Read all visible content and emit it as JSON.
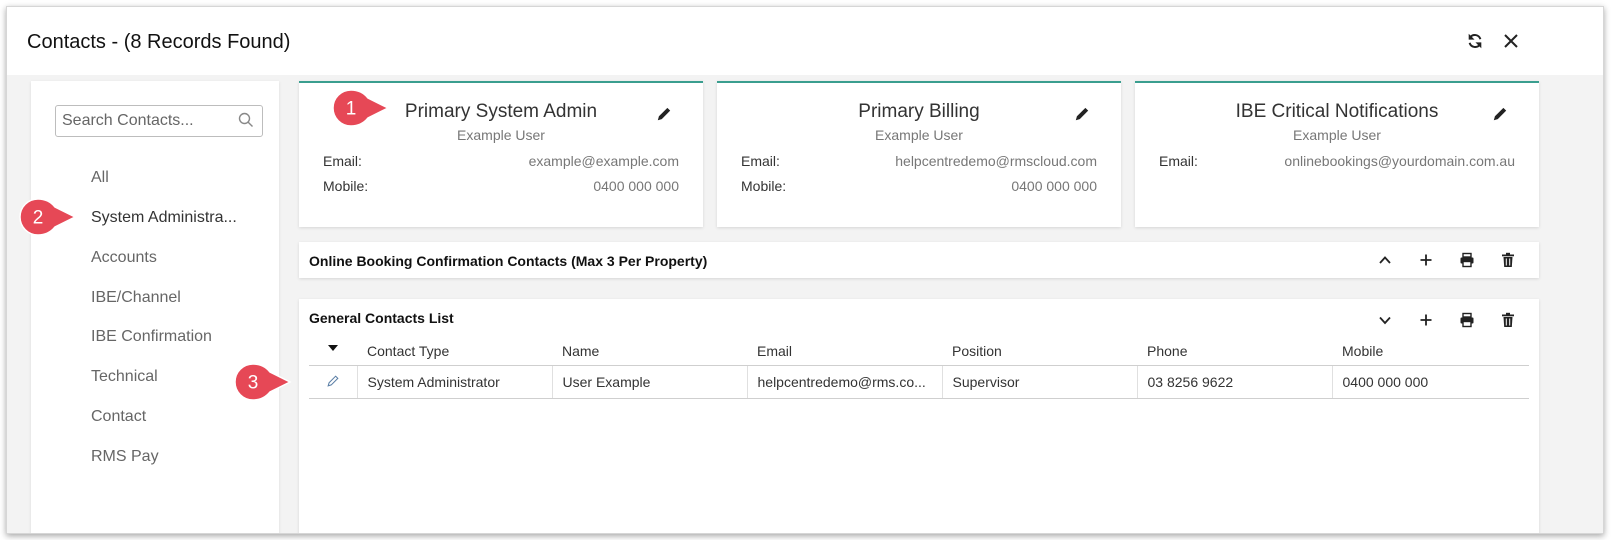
{
  "window": {
    "title": "Contacts - (8 Records Found)"
  },
  "search": {
    "placeholder": "Search Contacts..."
  },
  "sidebar": {
    "items": [
      {
        "label": "All"
      },
      {
        "label": "System Administra..."
      },
      {
        "label": "Accounts"
      },
      {
        "label": "IBE/Channel"
      },
      {
        "label": "IBE Confirmation"
      },
      {
        "label": "Technical"
      },
      {
        "label": "Contact"
      },
      {
        "label": "RMS Pay"
      }
    ],
    "active_index": 1
  },
  "cards": [
    {
      "title": "Primary System Admin",
      "subtitle": "Example User",
      "email_label": "Email:",
      "email": "example@example.com",
      "mobile_label": "Mobile:",
      "mobile": "0400 000 000"
    },
    {
      "title": "Primary Billing",
      "subtitle": "Example User",
      "email_label": "Email:",
      "email": "helpcentredemo@rmscloud.com",
      "mobile_label": "Mobile:",
      "mobile": "0400 000 000"
    },
    {
      "title": "IBE Critical Notifications",
      "subtitle": "Example User",
      "email_label": "Email:",
      "email": "onlinebookings@yourdomain.com.au"
    }
  ],
  "online_booking": {
    "title": "Online Booking Confirmation Contacts (Max 3 Per Property)"
  },
  "general_contacts": {
    "title": "General Contacts List",
    "columns": [
      "Contact Type",
      "Name",
      "Email",
      "Position",
      "Phone",
      "Mobile"
    ],
    "rows": [
      [
        "System Administrator",
        "User Example",
        "helpcentredemo@rms.co...",
        "Supervisor",
        "03 8256 9622",
        "0400 000 000"
      ]
    ]
  },
  "callouts": [
    "1",
    "2",
    "3"
  ],
  "colors": {
    "accent": "#3a9e8f",
    "callout": "#e64856"
  },
  "icons": [
    "refresh-icon",
    "close-icon",
    "search-icon",
    "pencil-icon",
    "chevron-up-icon",
    "chevron-down-icon",
    "plus-icon",
    "print-icon",
    "trash-icon",
    "sort-caret-icon",
    "edit-row-icon"
  ]
}
